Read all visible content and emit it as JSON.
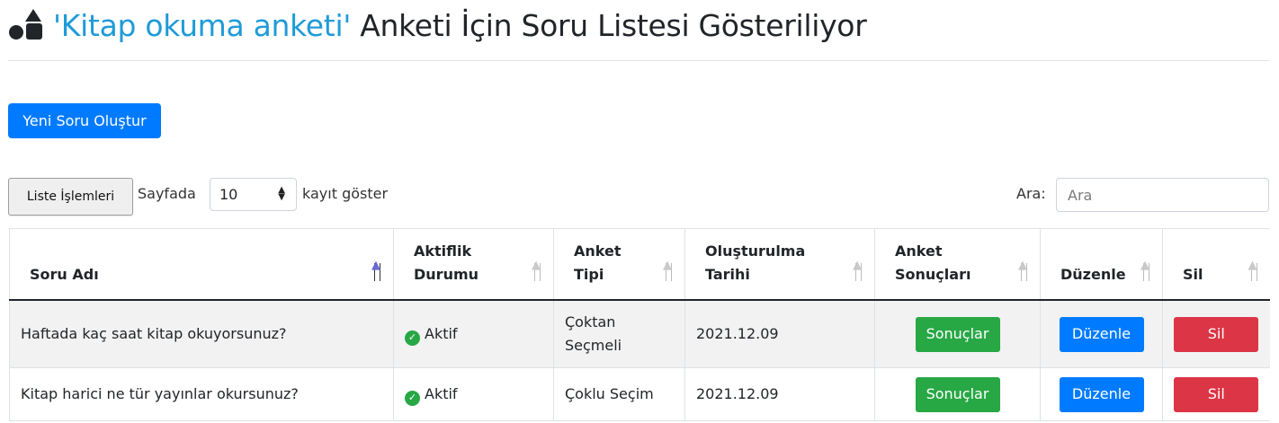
{
  "header": {
    "survey_name": "'Kitap okuma anketi'",
    "title_rest": " Anketi İçin Soru Listesi Gösteriliyor",
    "icon": "shapes-icon"
  },
  "toolbar": {
    "new_question_label": "Yeni Soru Oluştur",
    "list_operations_label": "Liste İşlemleri",
    "per_page_label": "Sayfada",
    "per_page_value": "10",
    "per_page_suffix": "kayıt göster",
    "search_label": "Ara:",
    "search_placeholder": "Ara"
  },
  "table": {
    "columns": [
      {
        "line1": "Soru Adı",
        "line2": ""
      },
      {
        "line1": "Aktiflik",
        "line2": "Durumu"
      },
      {
        "line1": "Anket",
        "line2": "Tipi"
      },
      {
        "line1": "Oluşturulma",
        "line2": "Tarihi"
      },
      {
        "line1": "Anket",
        "line2": "Sonuçları"
      },
      {
        "line1": "Düzenle",
        "line2": ""
      },
      {
        "line1": "Sil",
        "line2": ""
      }
    ],
    "rows": [
      {
        "question": "Haftada kaç saat kitap okuyorsunuz?",
        "status": "Aktif",
        "type_line1": "Çoktan",
        "type_line2": "Seçmeli",
        "date": "2021.12.09",
        "results_label": "Sonuçlar",
        "edit_label": "Düzenle",
        "delete_label": "Sil"
      },
      {
        "question": "Kitap harici ne tür yayınlar okursunuz?",
        "status": "Aktif",
        "type_line1": "Çoklu Seçim",
        "type_line2": "",
        "date": "2021.12.09",
        "results_label": "Sonuçlar",
        "edit_label": "Düzenle",
        "delete_label": "Sil"
      }
    ]
  },
  "colors": {
    "primary": "#007bff",
    "success": "#28a745",
    "danger": "#dc3545",
    "survey_link": "#1f9bd8"
  }
}
